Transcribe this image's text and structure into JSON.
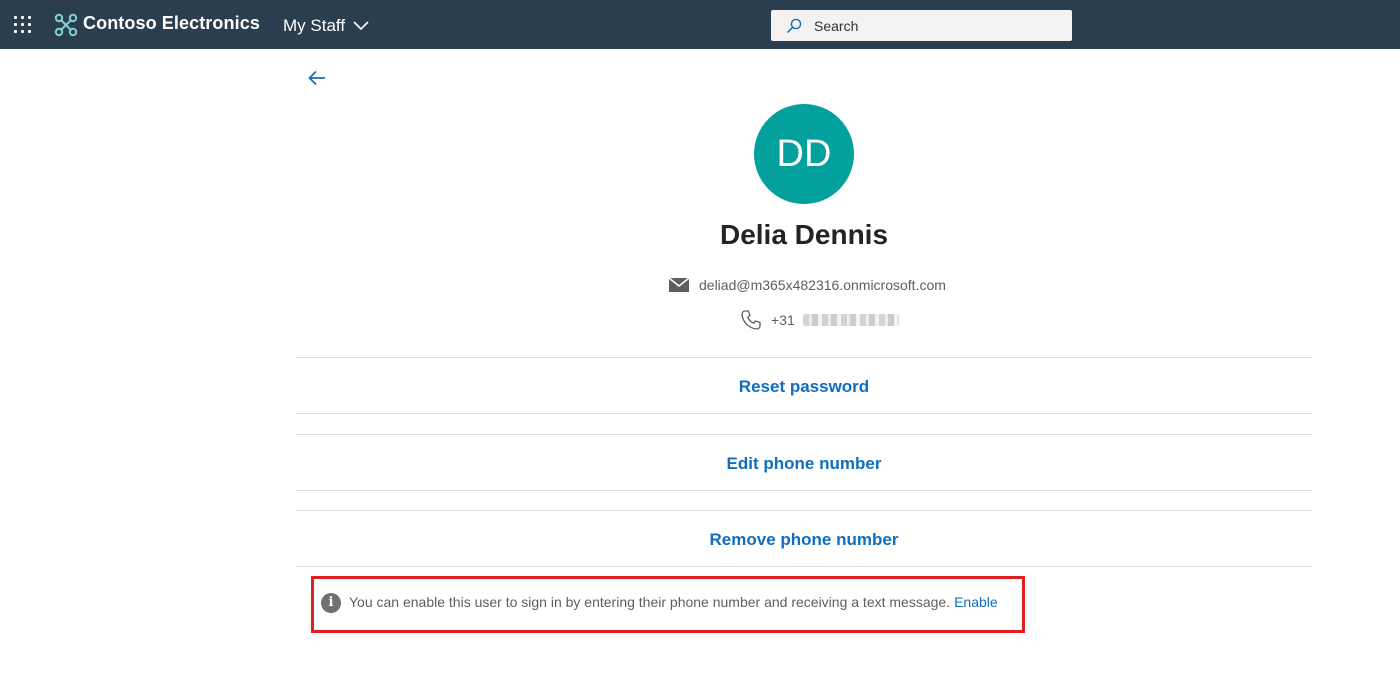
{
  "header": {
    "brand_name": "Contoso Electronics",
    "app_name": "My Staff",
    "search_placeholder": "Search",
    "background_color": "#2b3e50"
  },
  "user": {
    "initials": "DD",
    "avatar_color": "#03a09e",
    "name": "Delia Dennis",
    "email": "deliad@m365x482316.onmicrosoft.com",
    "phone_prefix": "+31"
  },
  "actions": [
    {
      "label": "Reset password"
    },
    {
      "label": "Edit phone number"
    },
    {
      "label": "Remove phone number"
    }
  ],
  "notice": {
    "text": "You can enable this user to sign in by entering their phone number and receiving a text message.",
    "link_label": "Enable",
    "highlight_color": "#e02020"
  },
  "colors": {
    "link": "#106ebe"
  }
}
